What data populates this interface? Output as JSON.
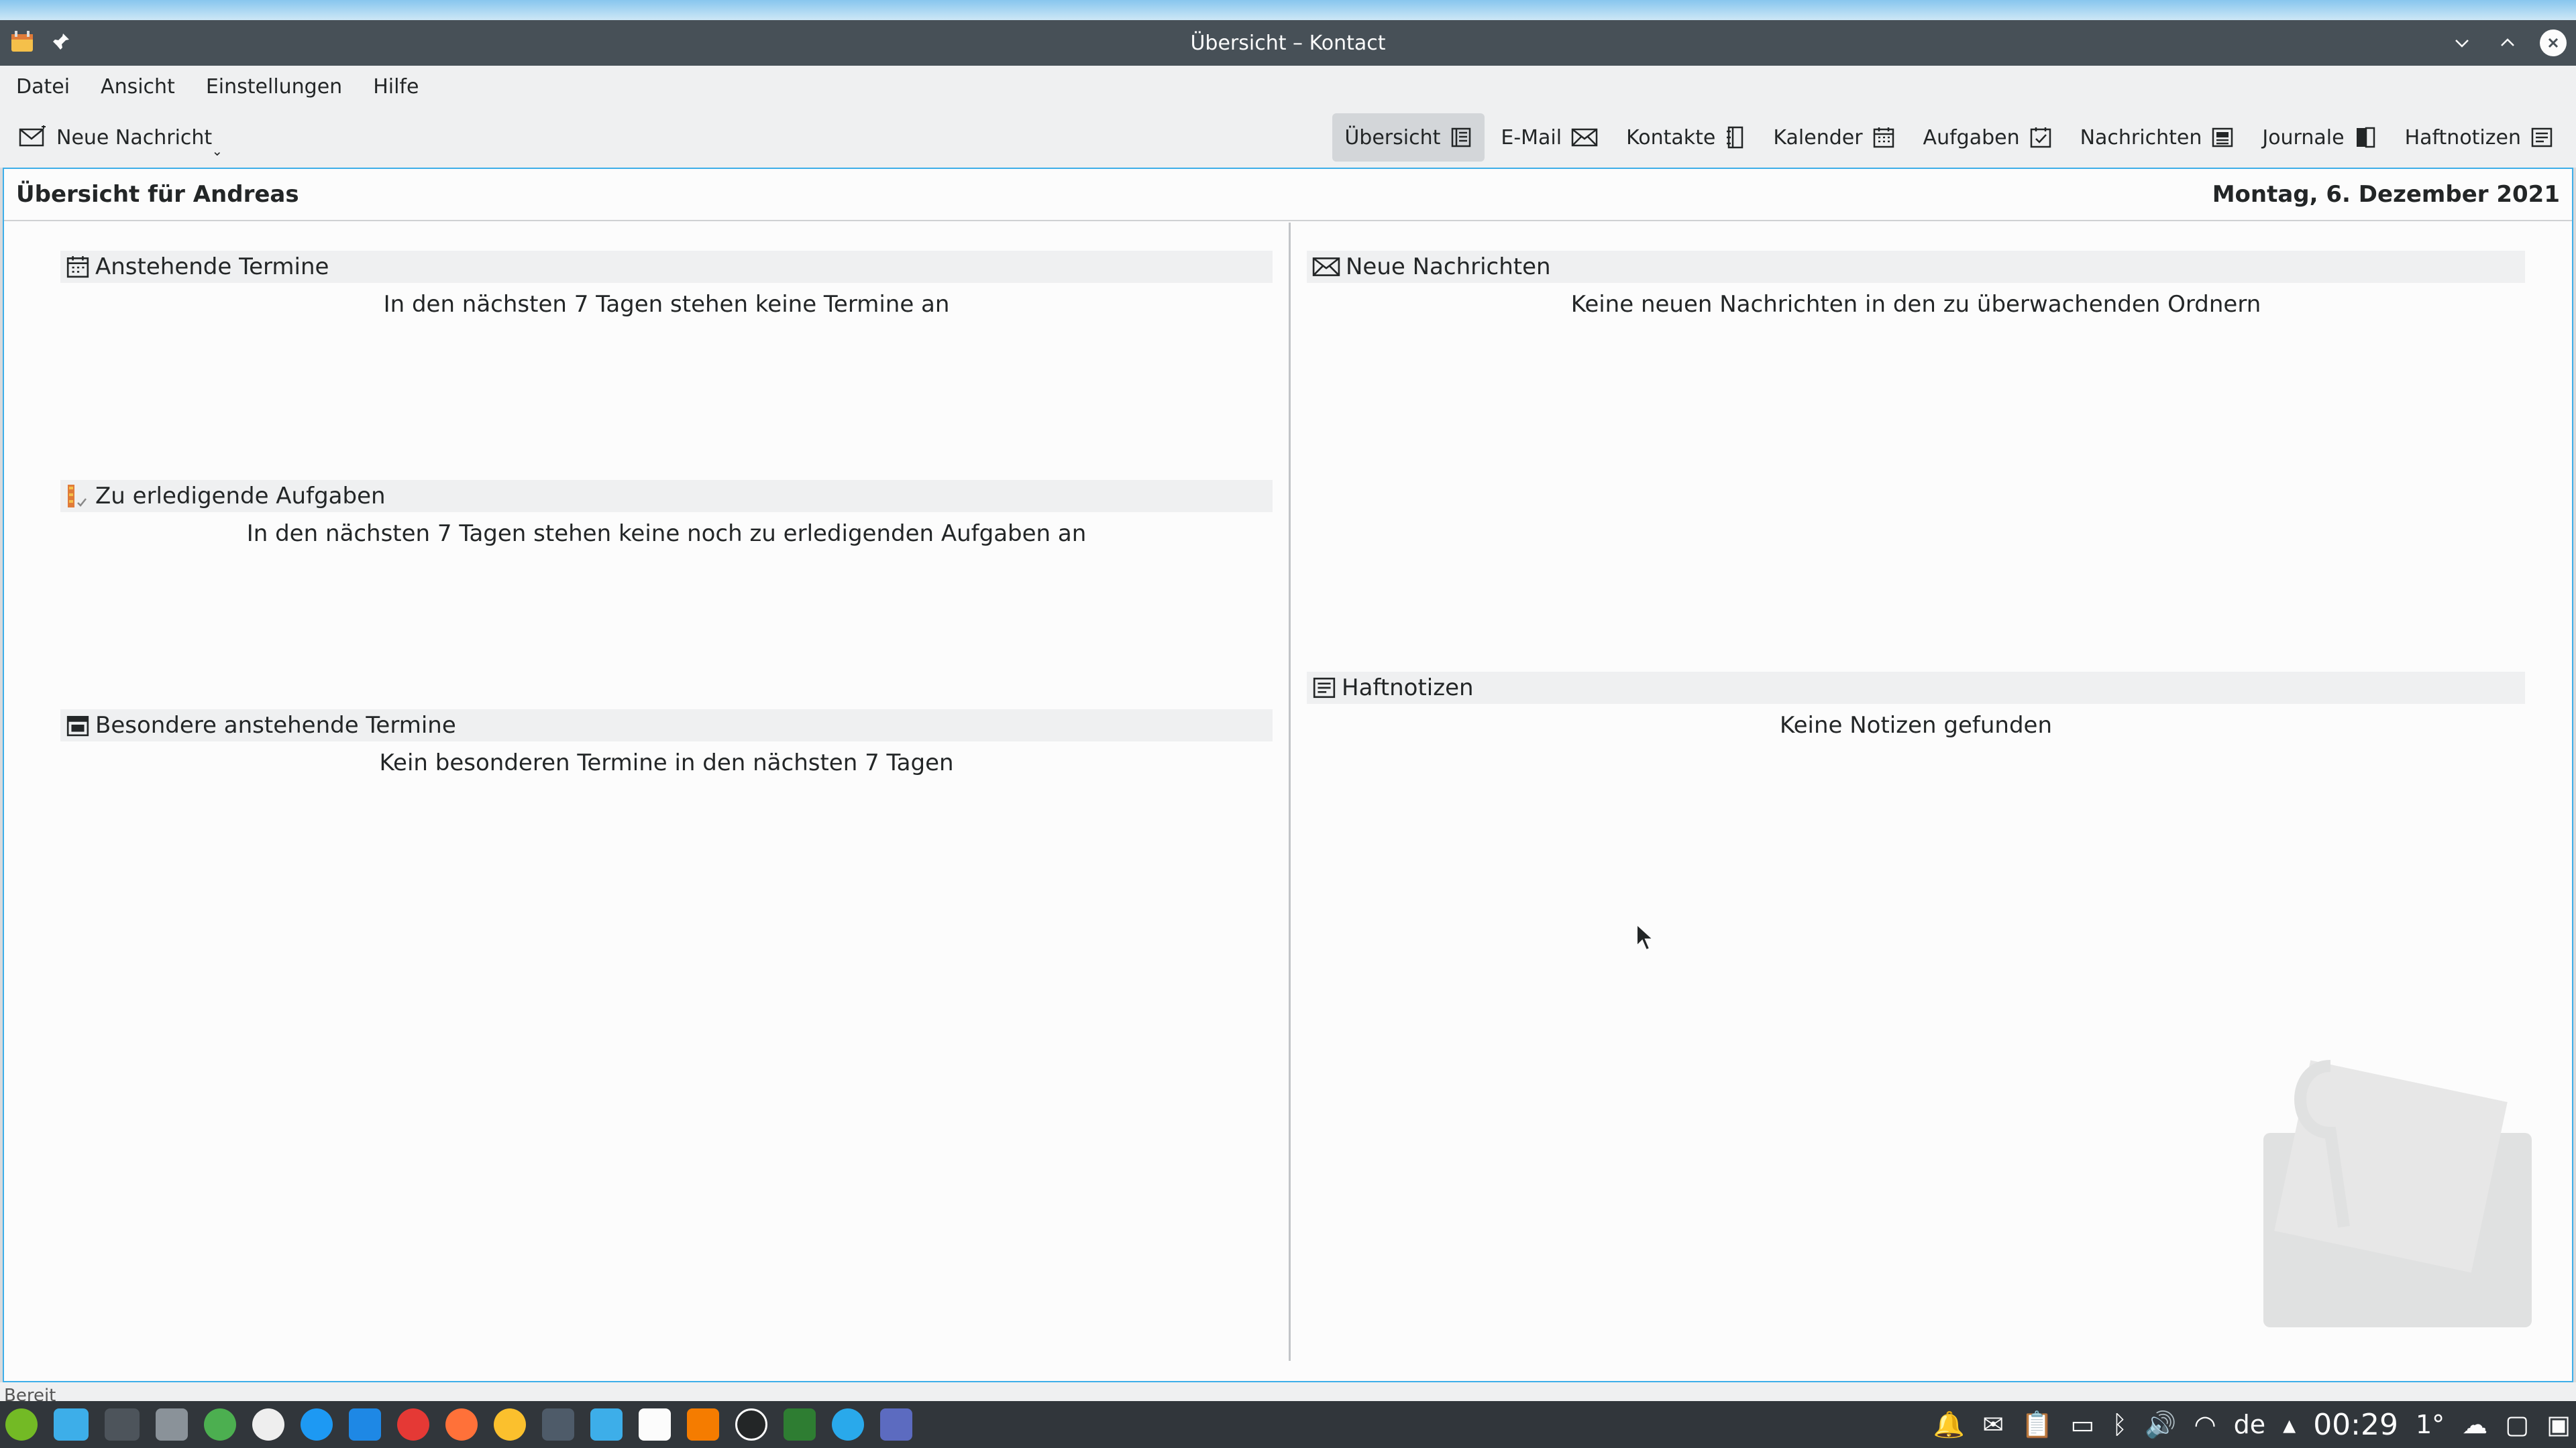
{
  "window": {
    "title": "Übersicht – Kontact"
  },
  "menubar": {
    "items": [
      "Datei",
      "Ansicht",
      "Einstellungen",
      "Hilfe"
    ]
  },
  "toolbar": {
    "new_message": "Neue Nachricht",
    "tabs": [
      {
        "label": "Übersicht",
        "icon": "summary-icon",
        "active": true
      },
      {
        "label": "E-Mail",
        "icon": "mail-icon",
        "active": false
      },
      {
        "label": "Kontakte",
        "icon": "contacts-icon",
        "active": false
      },
      {
        "label": "Kalender",
        "icon": "calendar-icon",
        "active": false
      },
      {
        "label": "Aufgaben",
        "icon": "tasks-icon",
        "active": false
      },
      {
        "label": "Nachrichten",
        "icon": "news-icon",
        "active": false
      },
      {
        "label": "Journale",
        "icon": "journal-icon",
        "active": false
      },
      {
        "label": "Haftnotizen",
        "icon": "notes-icon",
        "active": false
      }
    ]
  },
  "summary": {
    "title": "Übersicht für Andreas",
    "date": "Montag, 6. Dezember 2021"
  },
  "left_sections": [
    {
      "title": "Anstehende Termine",
      "icon": "calendar-icon",
      "message": "In den nächsten 7 Tagen stehen keine Termine an"
    },
    {
      "title": "Zu erledigende Aufgaben",
      "icon": "tasks-icon",
      "message": "In den nächsten 7 Tagen stehen keine noch zu erledigenden Aufgaben an"
    },
    {
      "title": "Besondere anstehende Termine",
      "icon": "special-dates-icon",
      "message": "Kein besonderen Termine in den nächsten 7 Tagen"
    }
  ],
  "right_sections": [
    {
      "title": "Neue Nachrichten",
      "icon": "mail-icon",
      "message": "Keine neuen Nachrichten in den zu überwachenden Ordnern"
    },
    {
      "title": "Haftnotizen",
      "icon": "notes-icon",
      "message": "Keine Notizen gefunden"
    }
  ],
  "statusbar": {
    "text": "Bereit"
  },
  "taskbar": {
    "keyboard_layout": "de",
    "clock": "00:29",
    "temperature": "1°"
  },
  "colors": {
    "accent": "#3daee9",
    "titlebar": "#475057",
    "panel": "#31363b"
  }
}
